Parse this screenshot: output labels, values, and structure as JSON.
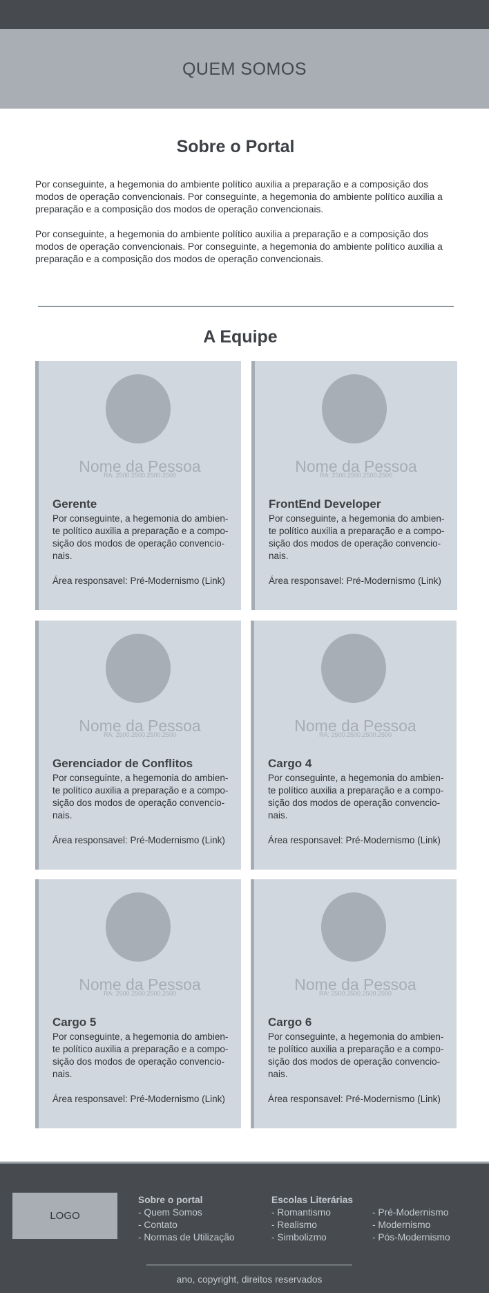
{
  "hero": {
    "title": "QUEM SOMOS"
  },
  "about": {
    "title": "Sobre  o Portal",
    "paragraphs": [
      "Por conseguinte, a hegemonia do ambiente político auxilia a preparação e a composição dos modos de operação convencionais. Por conseguinte, a hegemonia do ambiente político auxilia a preparação e a composição dos modos de operação convencionais.",
      "Por conseguinte, a hegemonia do ambiente político auxilia a preparação e a composição dos modos de operação convencionais. Por conseguinte, a hegemonia do ambiente político auxilia a preparação e a composição dos modos de operação convencionais."
    ]
  },
  "team": {
    "title": "A Equipe",
    "members": [
      {
        "name": "Nome da Pessoa",
        "ra": "RA: 2500.2500.2500.2500",
        "role": "Gerente",
        "desc": "Por conseguinte, a hegemonia do ambien-te político auxilia a preparação e a compo-sição dos modos de operação convencio-nais.",
        "area": "Área responsavel: Pré-Modernismo (Link)"
      },
      {
        "name": "Nome da Pessoa",
        "ra": "RA: 2500.2500.2500.2500",
        "role": "FrontEnd Developer",
        "desc": "Por conseguinte, a hegemonia do ambien-te político auxilia a preparação e a compo-sição dos modos de operação convencio-nais.",
        "area": "Área responsavel: Pré-Modernismo (Link)"
      },
      {
        "name": "Nome da Pessoa",
        "ra": "RA: 2500.2500.2500.2500",
        "role": "Gerenciador de Conflitos",
        "desc": "Por conseguinte, a hegemonia do ambien-te político auxilia a preparação e a compo-sição dos modos de operação convencio-nais.",
        "area": "Área responsavel: Pré-Modernismo (Link)"
      },
      {
        "name": "Nome da Pessoa",
        "ra": "RA: 2500.2500.2500.2500",
        "role": "Cargo 4",
        "desc": "Por conseguinte, a hegemonia do ambien-te político auxilia a preparação e a compo-sição dos modos de operação convencio-nais.",
        "area": "Área responsavel: Pré-Modernismo (Link)"
      },
      {
        "name": "Nome da Pessoa",
        "ra": "RA: 2500.2500.2500.2500",
        "role": "Cargo 5",
        "desc": "Por conseguinte, a hegemonia do ambien-te político auxilia a preparação e a compo-sição dos modos de operação convencio-nais.",
        "area": "Área responsavel: Pré-Modernismo (Link)"
      },
      {
        "name": "Nome da Pessoa",
        "ra": "RA: 2500.2500.2500.2500",
        "role": "Cargo 6",
        "desc": "Por conseguinte, a hegemonia do ambien-te político auxilia a preparação e a compo-sição dos modos de operação convencio-nais.",
        "area": "Área responsavel: Pré-Modernismo (Link)"
      }
    ]
  },
  "footer": {
    "logo": "LOGO",
    "col1": {
      "heading": "Sobre o portal",
      "links": [
        "- Quem Somos",
        "- Contato",
        "- Normas de Utilização"
      ]
    },
    "col2": {
      "heading": "Escolas Literárias",
      "links": [
        "- Romantismo",
        "- Realismo",
        "- Simbolizmo"
      ]
    },
    "col3": {
      "links": [
        "- Pré-Modernismo",
        "- Modernismo",
        "- Pós-Modernismo"
      ]
    },
    "copyright": "ano, copyright, direitos reservados"
  }
}
